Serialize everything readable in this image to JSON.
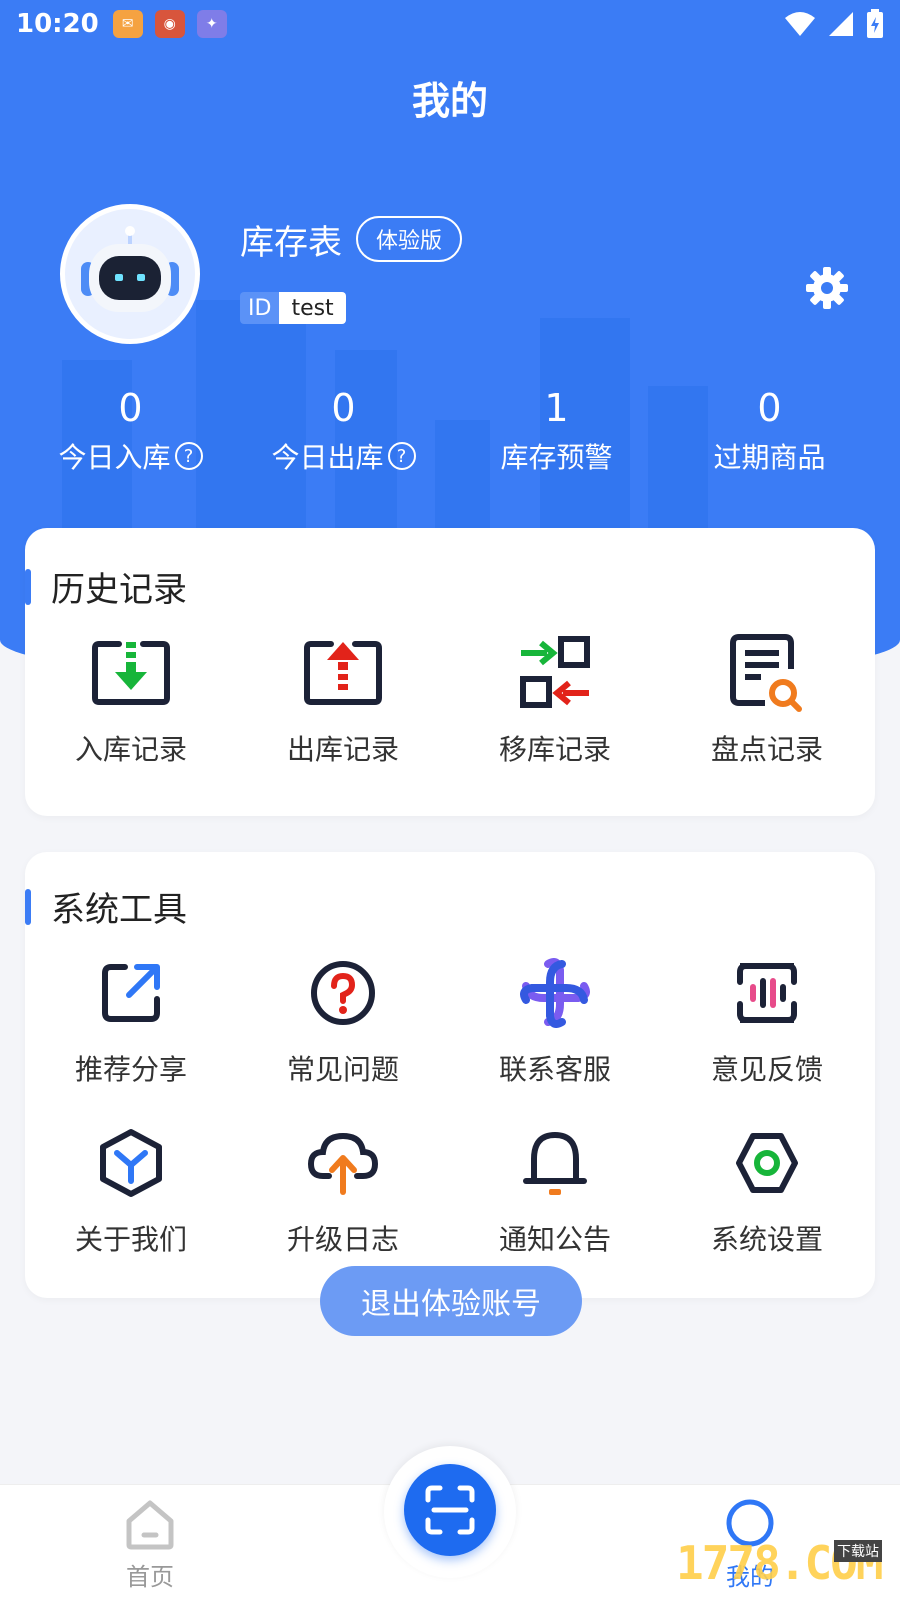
{
  "status_bar": {
    "time": "10:20"
  },
  "header": {
    "title": "我的"
  },
  "profile": {
    "name": "库存表",
    "badge": "体验版",
    "id_label": "ID",
    "id_value": "test"
  },
  "stats": [
    {
      "value": "0",
      "label": "今日入库",
      "has_help": true
    },
    {
      "value": "0",
      "label": "今日出库",
      "has_help": true
    },
    {
      "value": "1",
      "label": "库存预警",
      "has_help": false
    },
    {
      "value": "0",
      "label": "过期商品",
      "has_help": false
    }
  ],
  "history": {
    "title": "历史记录",
    "items": [
      {
        "label": "入库记录",
        "icon": "inbound-record-icon"
      },
      {
        "label": "出库记录",
        "icon": "outbound-record-icon"
      },
      {
        "label": "移库记录",
        "icon": "transfer-record-icon"
      },
      {
        "label": "盘点记录",
        "icon": "inventory-check-icon"
      }
    ]
  },
  "tools": {
    "title": "系统工具",
    "items": [
      {
        "label": "推荐分享",
        "icon": "share-icon"
      },
      {
        "label": "常见问题",
        "icon": "question-icon"
      },
      {
        "label": "联系客服",
        "icon": "customer-service-icon"
      },
      {
        "label": "意见反馈",
        "icon": "feedback-icon"
      },
      {
        "label": "关于我们",
        "icon": "about-icon"
      },
      {
        "label": "升级日志",
        "icon": "upgrade-log-icon"
      },
      {
        "label": "通知公告",
        "icon": "bell-icon"
      },
      {
        "label": "系统设置",
        "icon": "system-settings-icon"
      }
    ]
  },
  "logout_label": "退出体验账号",
  "tabbar": {
    "home_label": "首页",
    "mine_label": "我的"
  },
  "watermark": {
    "text": "1778.COM",
    "sub": "下载站"
  },
  "colors": {
    "primary": "#3b7cf5",
    "green": "#17b53a",
    "red": "#e2231a",
    "orange": "#f07b1e"
  }
}
